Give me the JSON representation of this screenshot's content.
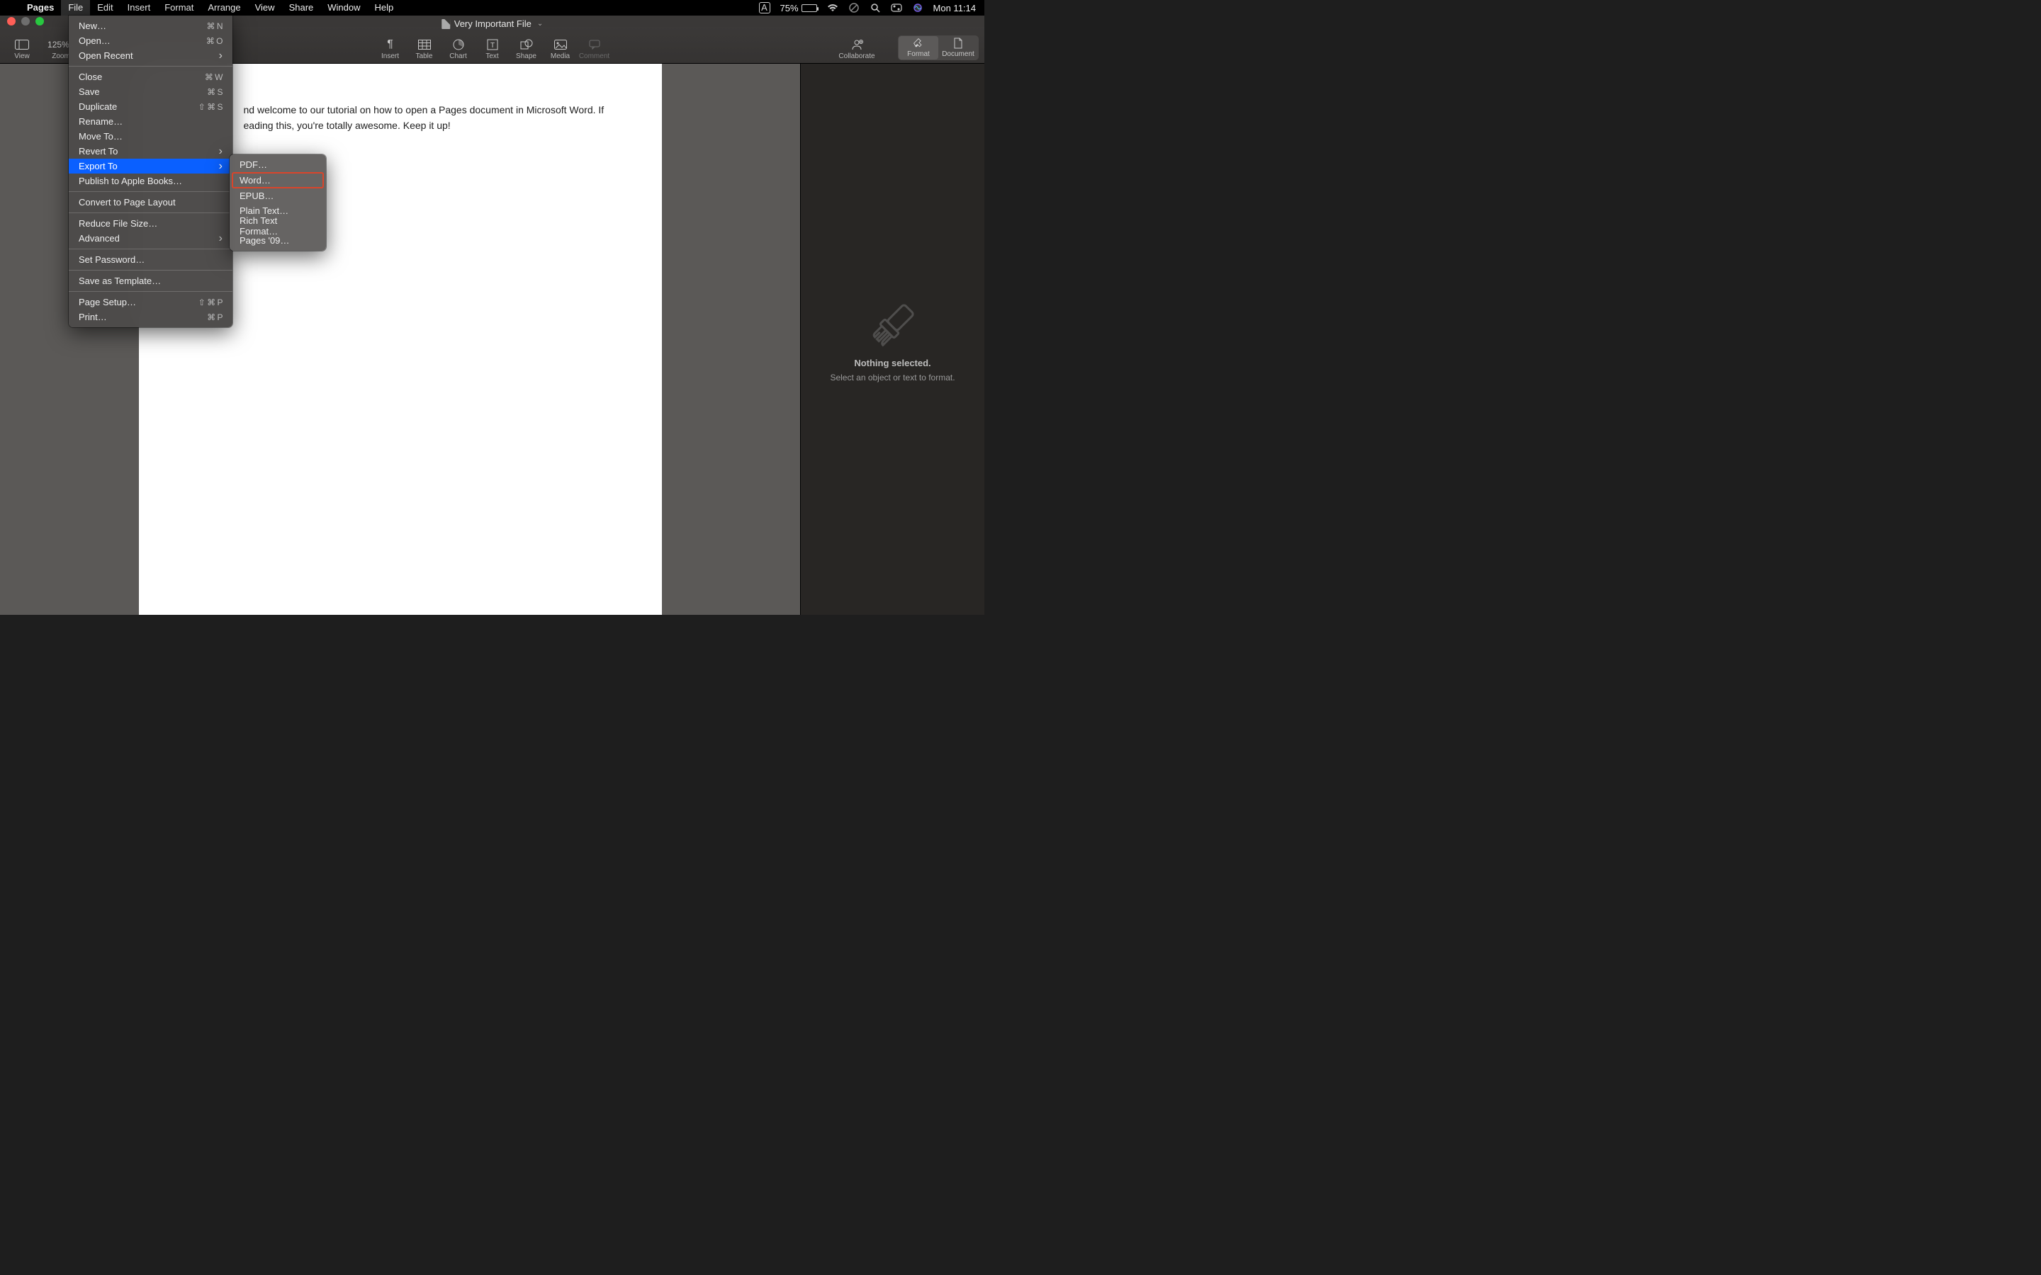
{
  "menubar": {
    "app_name": "Pages",
    "items": [
      "File",
      "Edit",
      "Insert",
      "Format",
      "Arrange",
      "View",
      "Share",
      "Window",
      "Help"
    ],
    "open_index": 0
  },
  "status_bar": {
    "input_indicator": "A",
    "battery_pct": "75%",
    "clock": "Mon 11:14"
  },
  "window": {
    "title": "Very Important File"
  },
  "toolbar": {
    "left": [
      {
        "label": "View",
        "icon": "sidebar-icon"
      },
      {
        "label": "Zoom",
        "icon": "zoom-dropdown",
        "value": "125%"
      }
    ],
    "center": [
      {
        "label": "Insert",
        "icon": "pilcrow-icon"
      },
      {
        "label": "Table",
        "icon": "table-icon"
      },
      {
        "label": "Chart",
        "icon": "chart-icon"
      },
      {
        "label": "Text",
        "icon": "text-icon"
      },
      {
        "label": "Shape",
        "icon": "shape-icon"
      },
      {
        "label": "Media",
        "icon": "media-icon"
      },
      {
        "label": "Comment",
        "icon": "comment-icon",
        "disabled": true
      }
    ],
    "collab_label": "Collaborate",
    "right_segments": [
      {
        "label": "Format",
        "icon": "brush-icon",
        "active": true
      },
      {
        "label": "Document",
        "icon": "document-icon",
        "active": false
      }
    ]
  },
  "file_menu": {
    "items": [
      {
        "label": "New…",
        "shortcut": "⌘ N"
      },
      {
        "label": "Open…",
        "shortcut": "⌘ O"
      },
      {
        "label": "Open Recent",
        "submenu": true
      },
      {
        "sep": true
      },
      {
        "label": "Close",
        "shortcut": "⌘ W"
      },
      {
        "label": "Save",
        "shortcut": "⌘ S"
      },
      {
        "label": "Duplicate",
        "shortcut": "⇧ ⌘ S"
      },
      {
        "label": "Rename…"
      },
      {
        "label": "Move To…"
      },
      {
        "label": "Revert To",
        "submenu": true
      },
      {
        "label": "Export To",
        "submenu": true,
        "highlight": true
      },
      {
        "label": "Publish to Apple Books…"
      },
      {
        "sep": true
      },
      {
        "label": "Convert to Page Layout"
      },
      {
        "sep": true
      },
      {
        "label": "Reduce File Size…"
      },
      {
        "label": "Advanced",
        "submenu": true
      },
      {
        "sep": true
      },
      {
        "label": "Set Password…"
      },
      {
        "sep": true
      },
      {
        "label": "Save as Template…"
      },
      {
        "sep": true
      },
      {
        "label": "Page Setup…",
        "shortcut": "⇧ ⌘ P"
      },
      {
        "label": "Print…",
        "shortcut": "⌘ P"
      }
    ]
  },
  "export_submenu": {
    "items": [
      {
        "label": "PDF…"
      },
      {
        "label": "Word…",
        "boxed": true
      },
      {
        "label": "EPUB…"
      },
      {
        "label": "Plain Text…"
      },
      {
        "label": "Rich Text Format…"
      },
      {
        "label": "Pages '09…"
      }
    ]
  },
  "document": {
    "visible_line1": "nd welcome to our tutorial on how to open a Pages document in Microsoft Word. If",
    "visible_line2": "eading this, you're totally awesome. Keep it up!"
  },
  "inspector": {
    "title": "Nothing selected.",
    "subtitle": "Select an object or text to format."
  }
}
